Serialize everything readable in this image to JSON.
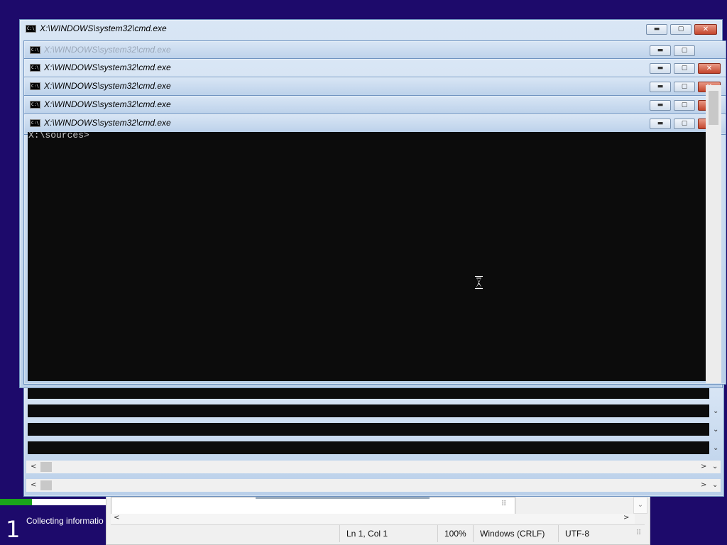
{
  "cmd_windows": [
    {
      "title": "X:\\WINDOWS\\system32\\cmd.exe"
    },
    {
      "title": "X:\\WINDOWS\\system32\\cmd.exe"
    },
    {
      "title": "X:\\WINDOWS\\system32\\cmd.exe"
    },
    {
      "title": "X:\\WINDOWS\\system32\\cmd.exe"
    },
    {
      "title": "X:\\WINDOWS\\system32\\cmd.exe"
    },
    {
      "title": "X:\\WINDOWS\\system32\\cmd.exe"
    }
  ],
  "console": {
    "prompt": "X:\\sources>"
  },
  "caption_buttons": {
    "minimize": "▬",
    "maximize": "▢",
    "close": "✕"
  },
  "icons": {
    "cmd": "cmd-icon",
    "busy_cursor": "hourglass-icon",
    "scroll_left": "◀",
    "scroll_right": "▶",
    "scroll_down": "▼"
  },
  "scroll_glyphs": {
    "left": "<",
    "right": ">",
    "down": "⌄"
  },
  "setup": {
    "step_number": "1",
    "step_text": "Collecting informatio",
    "progress": 0.3
  },
  "notepad_status": {
    "position": "Ln 1, Col 1",
    "zoom": "100%",
    "line_endings": "Windows (CRLF)",
    "encoding": "UTF-8"
  },
  "colors": {
    "desktop": "#1d0a6b",
    "console_bg": "#0c0c0c",
    "titlebar": "#c5d7ee",
    "progress": "#1aa51a",
    "close_button": "#c4452c"
  }
}
